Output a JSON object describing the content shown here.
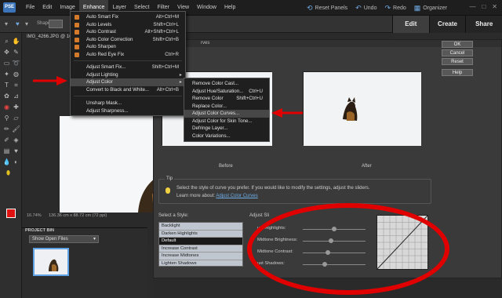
{
  "app": {
    "logo_text": "PSE"
  },
  "menubar": {
    "items": [
      "File",
      "Edit",
      "Image",
      "Enhance",
      "Layer",
      "Select",
      "Filter",
      "View",
      "Window",
      "Help"
    ],
    "active": "Enhance"
  },
  "topbar": {
    "reset_panels": "Reset Panels",
    "undo": "Undo",
    "redo": "Redo",
    "organizer": "Organizer"
  },
  "optionsbar": {
    "shape_label": "Shape:"
  },
  "tabs": [
    "Edit",
    "Create",
    "Share"
  ],
  "document": {
    "tab_title": "IMG_4266.JPG @ 16.7",
    "zoom": "16.74%",
    "size": "136.36 cm x 88.72 cm (72 ppi)"
  },
  "project_bin": {
    "title": "PROJECT BIN",
    "filter": "Show Open Files"
  },
  "enhance_menu": [
    {
      "label": "Auto Smart Fix",
      "shortcut": "Alt+Ctrl+M",
      "icon": true
    },
    {
      "label": "Auto Levels",
      "shortcut": "Shift+Ctrl+L",
      "icon": true
    },
    {
      "label": "Auto Contrast",
      "shortcut": "Alt+Shift+Ctrl+L",
      "icon": true
    },
    {
      "label": "Auto Color Correction",
      "shortcut": "Shift+Ctrl+B",
      "icon": true
    },
    {
      "label": "Auto Sharpen",
      "shortcut": "",
      "icon": true
    },
    {
      "label": "Auto Red Eye Fix",
      "shortcut": "Ctrl+R",
      "icon": true
    },
    {
      "label": "Adjust Smart Fix...",
      "shortcut": "Shift+Ctrl+M",
      "icon": false
    },
    {
      "label": "Adjust Lighting",
      "shortcut": "",
      "icon": false,
      "submenu": true
    },
    {
      "label": "Adjust Color",
      "shortcut": "",
      "icon": false,
      "submenu": true,
      "highlighted": true
    },
    {
      "label": "Convert to Black and White...",
      "shortcut": "Alt+Ctrl+B",
      "icon": false
    },
    {
      "label": "Unsharp Mask...",
      "shortcut": "",
      "icon": false
    },
    {
      "label": "Adjust Sharpness...",
      "shortcut": "",
      "icon": false
    }
  ],
  "adjust_color_submenu": [
    {
      "label": "Remove Color Cast...",
      "shortcut": ""
    },
    {
      "label": "Adjust Hue/Saturation...",
      "shortcut": "Ctrl+U"
    },
    {
      "label": "Remove Color",
      "shortcut": "Shift+Ctrl+U"
    },
    {
      "label": "Replace Color...",
      "shortcut": ""
    },
    {
      "label": "Adjust Color Curves...",
      "shortcut": "",
      "highlighted": true
    },
    {
      "label": "Adjust Color for Skin Tone...",
      "shortcut": ""
    },
    {
      "label": "Defringe Layer...",
      "shortcut": ""
    },
    {
      "label": "Color Variations...",
      "shortcut": ""
    }
  ],
  "dialog": {
    "title": "rves",
    "before_label": "Before",
    "after_label": "After",
    "buttons": {
      "ok": "OK",
      "cancel": "Cancel",
      "reset": "Reset",
      "help": "Help"
    },
    "tip_title": "Tip",
    "tip_line1": "Select the style of curve you prefer. If you would like to modify the settings, adjust the sliders.",
    "tip_line2_prefix": "Learn more about:",
    "tip_link": "Adjust Color Curves",
    "style_label": "Select a Style:",
    "styles": [
      "Backlight",
      "Darken Highlights",
      "Default",
      "Increase Contrast",
      "Increase Midtones",
      "Lighten Shadows"
    ],
    "selected_style": "Default",
    "adjust_label": "Adjust Sli",
    "sliders": [
      {
        "label": "ust Highlights:",
        "value": 0.5
      },
      {
        "label": "Midtone Brightness:",
        "value": 0.45
      },
      {
        "label": "Midtone Contrast:",
        "value": 0.4
      },
      {
        "label": "ust Shadows:",
        "value": 0.35
      }
    ]
  },
  "colors": {
    "annotation_red": "#e00000",
    "foreground": "#e01111",
    "background": "#ffffff",
    "link": "#6faee8"
  }
}
